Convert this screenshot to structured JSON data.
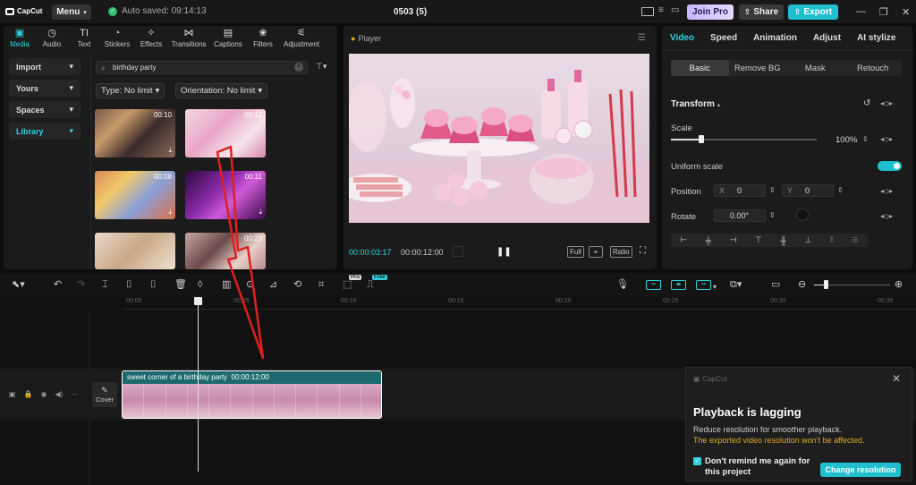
{
  "app": {
    "logo_text": "CapCut",
    "menu_label": "Menu",
    "autosave": "Auto saved: 09:14:13",
    "project_name": "0503 (5)",
    "join_pro": "Join Pro",
    "share": "Share",
    "export": "Export"
  },
  "media_tabs": [
    {
      "label": "Media",
      "icon": "media-icon"
    },
    {
      "label": "Audio",
      "icon": "audio-icon"
    },
    {
      "label": "Text",
      "icon": "text-icon"
    },
    {
      "label": "Stickers",
      "icon": "stickers-icon"
    },
    {
      "label": "Effects",
      "icon": "effects-icon"
    },
    {
      "label": "Transitions",
      "icon": "transitions-icon"
    },
    {
      "label": "Captions",
      "icon": "captions-icon"
    },
    {
      "label": "Filters",
      "icon": "filters-icon"
    },
    {
      "label": "Adjustment",
      "icon": "adjustment-icon"
    }
  ],
  "side_nav": [
    "Import",
    "Yours",
    "Spaces",
    "Library"
  ],
  "search": {
    "value": "birthday party"
  },
  "filters": {
    "type": "Type: No limit",
    "orientation": "Orientation: No limit"
  },
  "thumbs": [
    {
      "duration": "00:10",
      "scene": "family-party"
    },
    {
      "duration": "00:12",
      "scene": "pink-sweets"
    },
    {
      "duration": "00:08",
      "scene": "kids-party"
    },
    {
      "duration": "00:11",
      "scene": "purple-balloons"
    },
    {
      "duration": "",
      "scene": "girl-cake"
    },
    {
      "duration": "00:23",
      "scene": "boy-party"
    }
  ],
  "player": {
    "title": "Player",
    "current_time": "00:00:03:17",
    "total_time": "00:00:12:00",
    "full_label": "Full",
    "ratio_label": "Ratio"
  },
  "inspector": {
    "tabs": [
      "Video",
      "Speed",
      "Animation",
      "Adjust",
      "AI stylize"
    ],
    "subtabs": [
      "Basic",
      "Remove BG",
      "Mask",
      "Retouch"
    ],
    "section": "Transform",
    "scale_label": "Scale",
    "scale_value": "100%",
    "scale_level": 0.2,
    "uniform_label": "Uniform scale",
    "uniform_on": true,
    "position_label": "Position",
    "pos_x_label": "X",
    "pos_x": "0",
    "pos_y_label": "Y",
    "pos_y": "0",
    "rotate_label": "Rotate",
    "rotate_value": "0.00°"
  },
  "toolbar": {
    "pro_badge": "Pro",
    "free_badge": "Free"
  },
  "ruler_ticks": [
    "00:00",
    "00:05",
    "00:10",
    "00:15",
    "00:20",
    "00:25",
    "00:30",
    "00:35"
  ],
  "track": {
    "cover_label": "Cover",
    "clip_title": "sweet corner of a birthday party",
    "clip_duration": "00:00:12:00"
  },
  "toast": {
    "brand": "CapCut",
    "title": "Playback is lagging",
    "desc": "Reduce resolution for smoother playback.",
    "warning": "The exported video resolution won’t be affected.",
    "remind": "Don't remind me again for this project",
    "button": "Change resolution"
  },
  "colors": {
    "accent": "#1fbfcf",
    "annotation_arrow": "#e0201e",
    "warning": "#e0a92c"
  }
}
